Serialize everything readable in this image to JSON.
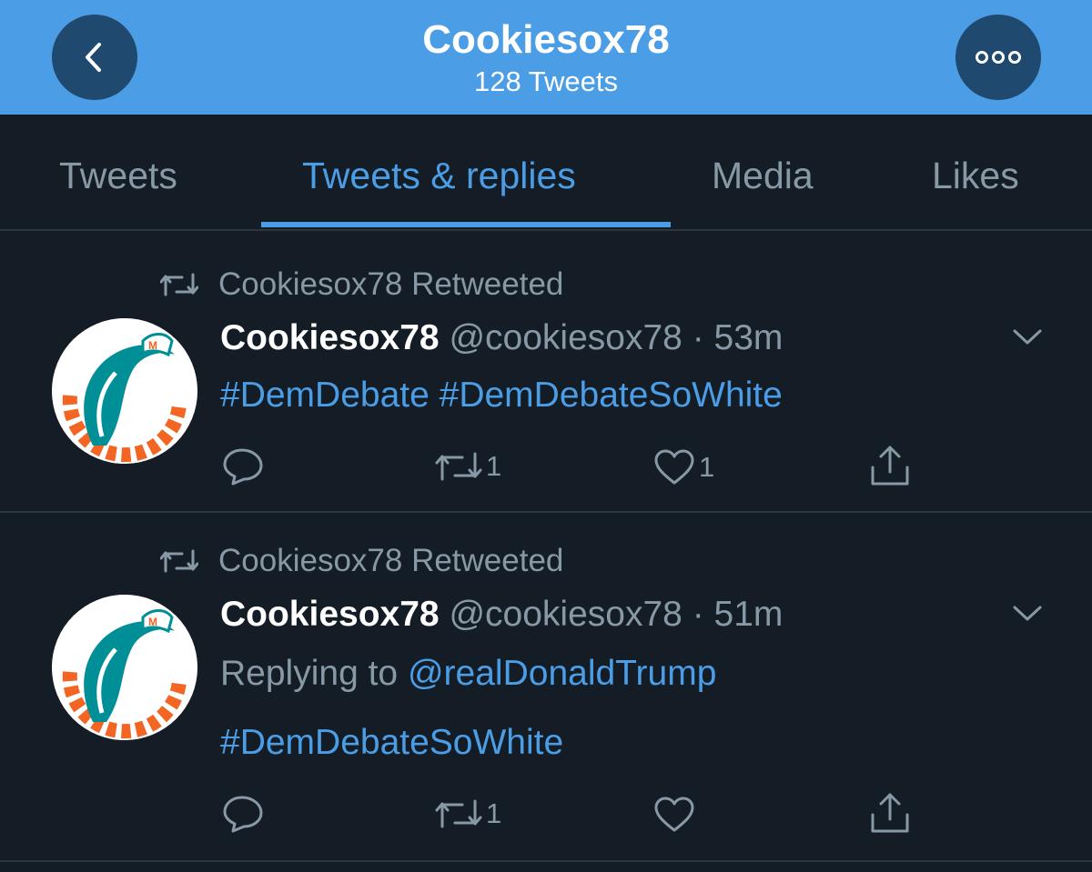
{
  "header": {
    "title": "Cookiesox78",
    "subtitle": "128 Tweets"
  },
  "tabs": [
    {
      "label": "Tweets"
    },
    {
      "label": "Tweets & replies"
    },
    {
      "label": "Media"
    },
    {
      "label": "Likes"
    }
  ],
  "tweets": [
    {
      "retweet_text": "Cookiesox78 Retweeted",
      "name": "Cookiesox78",
      "handle": "@cookiesox78",
      "separator": "·",
      "time": "53m",
      "hashtag1": "#DemDebate",
      "hashtag2": "#DemDebateSoWhite",
      "retweet_count": "1",
      "like_count": "1"
    },
    {
      "retweet_text": "Cookiesox78 Retweeted",
      "name": "Cookiesox78",
      "handle": "@cookiesox78",
      "separator": "·",
      "time": "51m",
      "replying_prefix": "Replying to",
      "replying_to": "@realDonaldTrump",
      "hashtag1": "#DemDebateSoWhite",
      "retweet_count": "1",
      "like_count": ""
    }
  ],
  "icons": {
    "back": "chevron-left-icon",
    "more": "more-dots-icon",
    "retweeted": "retweet-icon",
    "reply": "reply-icon",
    "retweet": "retweet-icon",
    "like": "heart-icon",
    "share": "share-icon",
    "caret": "chevron-down-icon"
  },
  "colors": {
    "header_bg": "#4b9de6",
    "page_bg": "#141d26",
    "accent": "#4b9de6",
    "muted": "#8899a6"
  }
}
